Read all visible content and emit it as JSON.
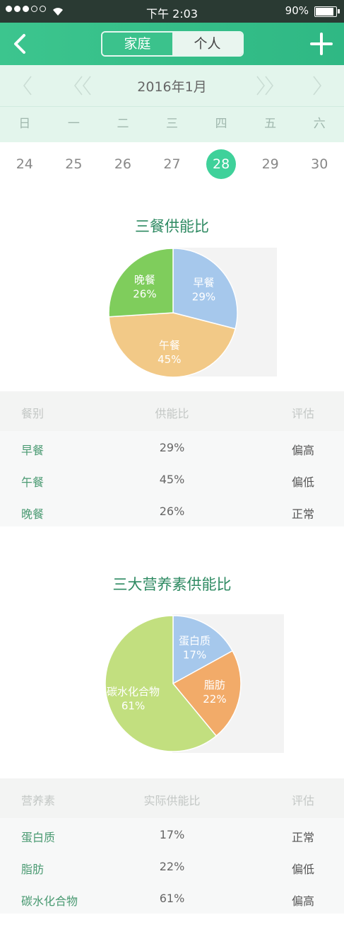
{
  "status_bar": {
    "time": "下午 2:03",
    "battery": "90%",
    "battery_level": 0.9
  },
  "nav": {
    "tabs": [
      {
        "label": "家庭",
        "active": true
      },
      {
        "label": "个人",
        "active": false
      }
    ]
  },
  "calendar": {
    "month": "2016年1月",
    "weekdays": [
      "日",
      "一",
      "二",
      "三",
      "四",
      "五",
      "六"
    ],
    "dates": [
      "24",
      "25",
      "26",
      "27",
      "28",
      "29",
      "30"
    ],
    "selected": "28"
  },
  "meal_section": {
    "title": "三餐供能比",
    "chart_data": {
      "type": "pie",
      "slices": [
        {
          "label": "早餐",
          "pct": "29%",
          "value": 29,
          "color": "#a6c8ec"
        },
        {
          "label": "午餐",
          "pct": "45%",
          "value": 45,
          "color": "#f2c987"
        },
        {
          "label": "晚餐",
          "pct": "26%",
          "value": 26,
          "color": "#7fcd5c"
        }
      ]
    },
    "table": {
      "headers": [
        "餐别",
        "供能比",
        "评估"
      ],
      "rows": [
        {
          "name": "早餐",
          "ratio": "29%",
          "eval": "偏高"
        },
        {
          "name": "午餐",
          "ratio": "45%",
          "eval": "偏低"
        },
        {
          "name": "晚餐",
          "ratio": "26%",
          "eval": "正常"
        }
      ]
    }
  },
  "nutrient_section": {
    "title": "三大营养素供能比",
    "chart_data": {
      "type": "pie",
      "slices": [
        {
          "label": "蛋白质",
          "pct": "17%",
          "value": 17,
          "color": "#a6c8ec"
        },
        {
          "label": "脂肪",
          "pct": "22%",
          "value": 22,
          "color": "#f2ab69"
        },
        {
          "label": "碳水化合物",
          "pct": "61%",
          "value": 61,
          "color": "#c2df7f"
        }
      ]
    },
    "table": {
      "headers": [
        "营养素",
        "实际供能比",
        "评估"
      ],
      "rows": [
        {
          "name": "蛋白质",
          "ratio": "17%",
          "eval": "正常"
        },
        {
          "name": "脂肪",
          "ratio": "22%",
          "eval": "偏低"
        },
        {
          "name": "碳水化合物",
          "ratio": "61%",
          "eval": "偏高"
        }
      ]
    }
  }
}
